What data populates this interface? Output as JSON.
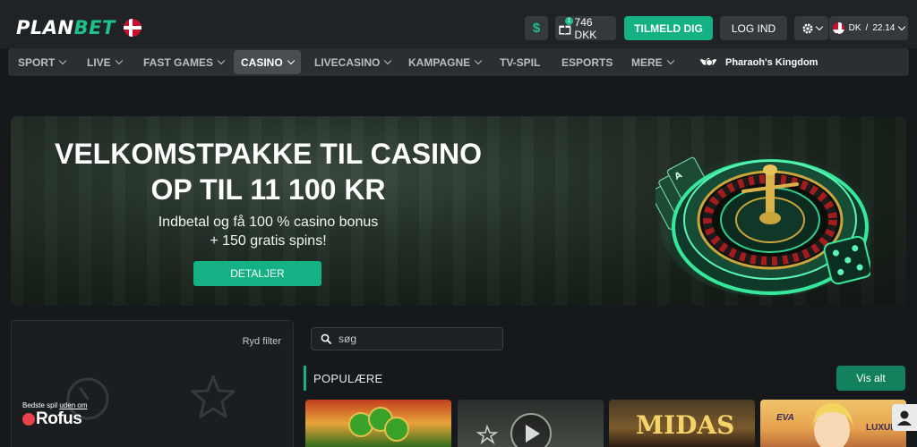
{
  "header": {
    "logo_part1": "PLAN",
    "logo_part2": "BET",
    "currency_icon": "$",
    "bonus_count": "1",
    "balance": "746 DKK",
    "signup_label": "TILMELD DIG",
    "login_label": "LOG IND",
    "language": "DK",
    "separator": "/",
    "time": "22.14"
  },
  "nav": {
    "items": [
      {
        "label": "SPORT"
      },
      {
        "label": "LIVE"
      },
      {
        "label": "FAST GAMES"
      },
      {
        "label": "CASINO"
      },
      {
        "label": "LIVECASINO"
      },
      {
        "label": "KAMPAGNE"
      },
      {
        "label": "TV-SPIL"
      },
      {
        "label": "ESPORTS"
      },
      {
        "label": "MERE"
      }
    ],
    "promo": "Pharaoh's Kingdom"
  },
  "banner": {
    "title_line1": "VELKOMSTPAKKE TIL CASINO",
    "title_line2": "OP TIL 11 100 KR",
    "subtitle_line1": "Indbetal og få 100 % casino bonus",
    "subtitle_line2": "+ 150 gratis spins!",
    "cta": "DETALJER"
  },
  "filter": {
    "clear_label": "Ryd filter"
  },
  "rofus": {
    "tagline_part1": "Bedste spil ",
    "tagline_part2": "uden om",
    "logo_text": "Rofus"
  },
  "search": {
    "placeholder": "søg"
  },
  "games": {
    "section_title": "POPULÆRE",
    "show_all": "Vis alt",
    "tiles": [
      {
        "label": ""
      },
      {
        "label": ""
      },
      {
        "label": "MIDAS"
      },
      {
        "label": "EVA"
      },
      {
        "label": "LUXUR"
      }
    ]
  },
  "colors": {
    "accent": "#13b183",
    "background": "#16191b",
    "nav_bg": "#2a2f32"
  }
}
